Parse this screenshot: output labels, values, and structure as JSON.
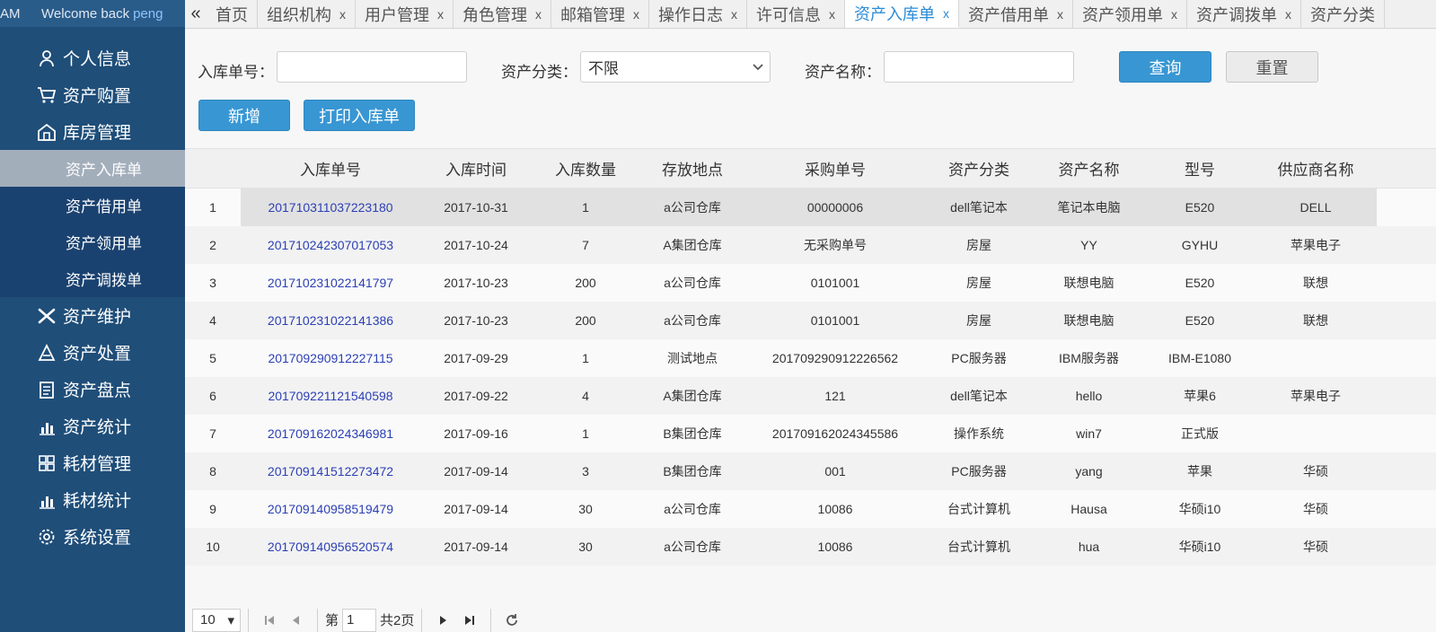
{
  "sidebar": {
    "am_label": "AM",
    "welcome": "Welcome back",
    "username": "peng",
    "menu": [
      {
        "label": "个人信息",
        "icon": "user-icon"
      },
      {
        "label": "资产购置",
        "icon": "cart-icon"
      },
      {
        "label": "库房管理",
        "icon": "warehouse-icon"
      },
      {
        "label": "资产维护",
        "icon": "tools-icon"
      },
      {
        "label": "资产处置",
        "icon": "dispose-icon"
      },
      {
        "label": "资产盘点",
        "icon": "clipboard-icon"
      },
      {
        "label": "资产统计",
        "icon": "bar-chart-icon"
      },
      {
        "label": "耗材管理",
        "icon": "grid-icon"
      },
      {
        "label": "耗材统计",
        "icon": "bar-chart-icon"
      },
      {
        "label": "系统设置",
        "icon": "gear-icon"
      }
    ],
    "submenu": [
      "资产入库单",
      "资产借用单",
      "资产领用单",
      "资产调拨单"
    ]
  },
  "tabs": [
    {
      "label": "首页",
      "closable": false
    },
    {
      "label": "组织机构",
      "closable": true
    },
    {
      "label": "用户管理",
      "closable": true
    },
    {
      "label": "角色管理",
      "closable": true
    },
    {
      "label": "邮箱管理",
      "closable": true
    },
    {
      "label": "操作日志",
      "closable": true
    },
    {
      "label": "许可信息",
      "closable": true
    },
    {
      "label": "资产入库单",
      "closable": true,
      "active": true
    },
    {
      "label": "资产借用单",
      "closable": true
    },
    {
      "label": "资产领用单",
      "closable": true
    },
    {
      "label": "资产调拨单",
      "closable": true
    },
    {
      "label": "资产分类",
      "closable": false
    }
  ],
  "tab_close_glyph": "x",
  "filters": {
    "order_no_label": "入库单号：",
    "order_no_value": "",
    "category_label": "资产分类：",
    "category_value": "不限",
    "name_label": "资产名称：",
    "name_value": "",
    "query_button": "查询",
    "reset_button": "重置",
    "add_button": "新增",
    "print_button": "打印入库单"
  },
  "table": {
    "columns": [
      "入库单号",
      "入库时间",
      "入库数量",
      "存放地点",
      "采购单号",
      "资产分类",
      "资产名称",
      "型号",
      "供应商名称"
    ],
    "rows": [
      [
        "201710311037223180",
        "2017-10-31",
        "1",
        "a公司仓库",
        "00000006",
        "dell笔记本",
        "笔记本电脑",
        "E520",
        "DELL"
      ],
      [
        "201710242307017053",
        "2017-10-24",
        "7",
        "A集团仓库",
        "无采购单号",
        "房屋",
        "YY",
        "GYHU",
        "苹果电子"
      ],
      [
        "201710231022141797",
        "2017-10-23",
        "200",
        "a公司仓库",
        "0101001",
        "房屋",
        "联想电脑",
        "E520",
        "联想"
      ],
      [
        "201710231022141386",
        "2017-10-23",
        "200",
        "a公司仓库",
        "0101001",
        "房屋",
        "联想电脑",
        "E520",
        "联想"
      ],
      [
        "201709290912227115",
        "2017-09-29",
        "1",
        "测试地点",
        "201709290912226562",
        "PC服务器",
        "IBM服务器",
        "IBM-E1080",
        ""
      ],
      [
        "201709221121540598",
        "2017-09-22",
        "4",
        "A集团仓库",
        "121",
        "dell笔记本",
        "hello",
        "苹果6",
        "苹果电子"
      ],
      [
        "201709162024346981",
        "2017-09-16",
        "1",
        "B集团仓库",
        "201709162024345586",
        "操作系统",
        "win7",
        "正式版",
        ""
      ],
      [
        "201709141512273472",
        "2017-09-14",
        "3",
        "B集团仓库",
        "001",
        "PC服务器",
        "yang",
        "苹果",
        "华硕"
      ],
      [
        "201709140958519479",
        "2017-09-14",
        "30",
        "a公司仓库",
        "10086",
        "台式计算机",
        "Hausa",
        "华硕i10",
        "华硕"
      ],
      [
        "201709140956520574",
        "2017-09-14",
        "30",
        "a公司仓库",
        "10086",
        "台式计算机",
        "hua",
        "华硕i10",
        "华硕"
      ]
    ]
  },
  "pager": {
    "page_size": "10",
    "page_prefix": "第",
    "page_value": "1",
    "total_pages": "共2页"
  },
  "colors": {
    "sidebar_bg": "#1f4e79",
    "accent": "#3896d3",
    "link": "#2b3fb5",
    "active_submenu": "#a3aebb"
  }
}
